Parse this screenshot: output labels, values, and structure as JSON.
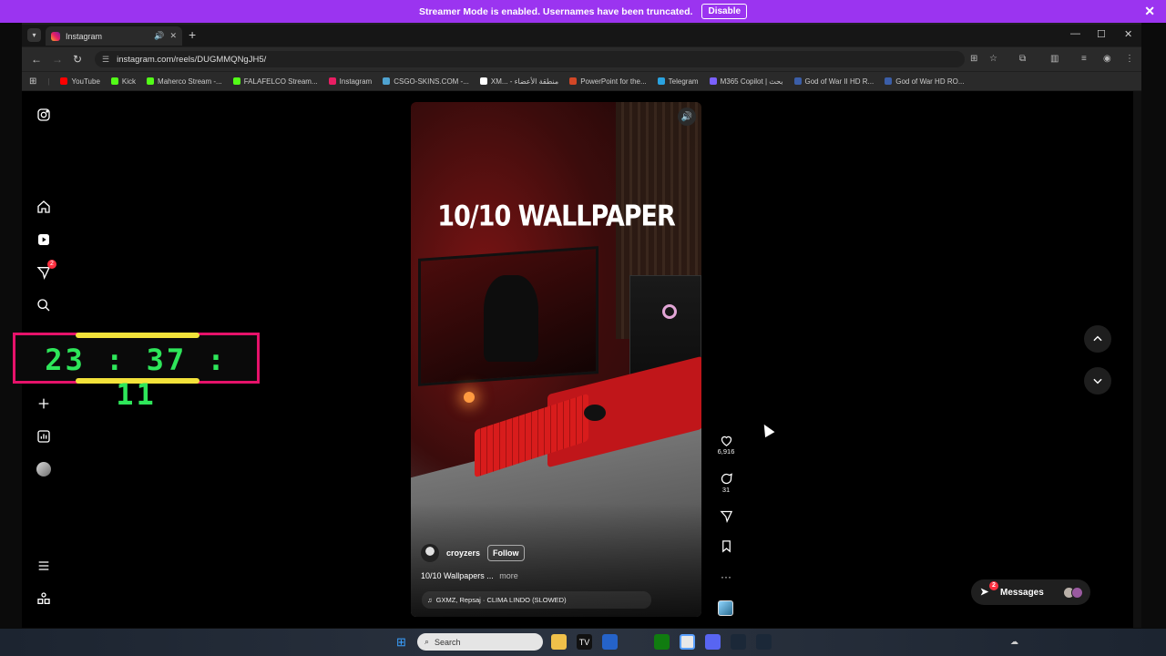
{
  "banner": {
    "text": "Streamer Mode is enabled. Usernames have been truncated.",
    "button": "Disable",
    "close": "✕"
  },
  "browser": {
    "tab_title": "Instagram",
    "new_tab": "+",
    "url": "instagram.com/reels/DUGMMQNgJH5/",
    "bookmarks": [
      {
        "label": "YouTube",
        "color": "#ff0000"
      },
      {
        "label": "Kick",
        "color": "#53fc18"
      },
      {
        "label": "Maherco Stream -...",
        "color": "#53fc18"
      },
      {
        "label": "FALAFELCO Stream...",
        "color": "#53fc18"
      },
      {
        "label": "Instagram",
        "color": "#e91e63"
      },
      {
        "label": "CSGO-SKINS.COM -...",
        "color": "#4fa3d1"
      },
      {
        "label": "XM... - منطقة الأعضاء",
        "color": "#ffffff"
      },
      {
        "label": "PowerPoint for the...",
        "color": "#d24726"
      },
      {
        "label": "Telegram",
        "color": "#2aa3e0"
      },
      {
        "label": "M365 Copilot | بحث",
        "color": "#7b61ff"
      },
      {
        "label": "God of War II HD R...",
        "color": "#3b5ea8"
      },
      {
        "label": "God of War HD RO...",
        "color": "#3b5ea8"
      }
    ]
  },
  "clock": {
    "time": "23 : 37 : 11"
  },
  "sidebar": {
    "notification_count": "2"
  },
  "reel": {
    "headline": "10/10 WALLPAPER",
    "username": "croyzers",
    "follow_label": "Follow",
    "caption": "10/10 Wallpapers ...",
    "more_label": "more",
    "music": "GXMZ, Repsaj · CLIMA LINDO (SLOWED)",
    "likes": "6,916",
    "comments": "31"
  },
  "messages": {
    "label": "Messages",
    "badge": "2"
  },
  "taskbar": {
    "search_placeholder": "Search"
  }
}
